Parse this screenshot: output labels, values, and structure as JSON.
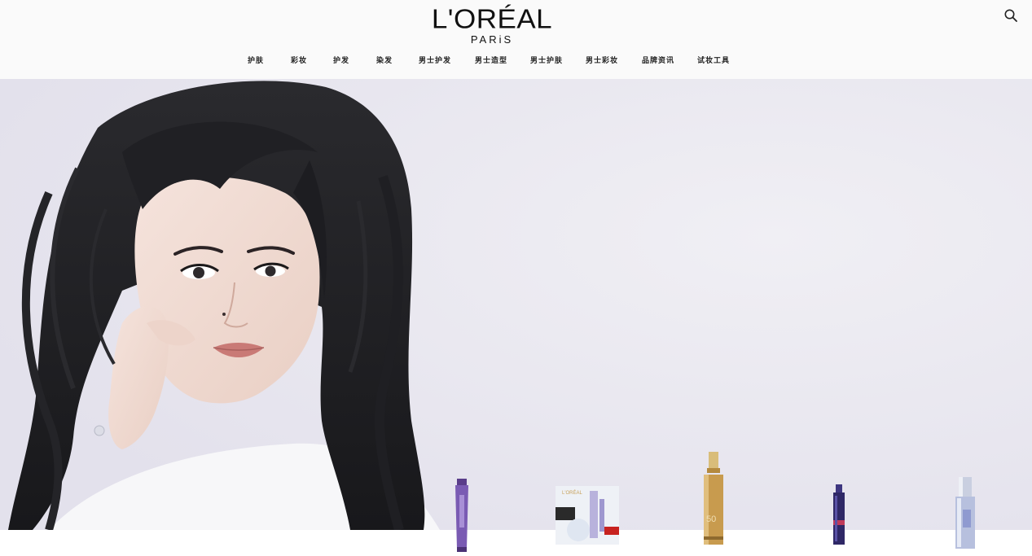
{
  "brand": {
    "name": "L'ORÉAL",
    "sub": "PARiS"
  },
  "search": {
    "icon": "search-icon"
  },
  "nav": {
    "items": [
      {
        "label": "护肤"
      },
      {
        "label": "彩妆"
      },
      {
        "label": "护发"
      },
      {
        "label": "染发"
      },
      {
        "label": "男士护发"
      },
      {
        "label": "男士造型"
      },
      {
        "label": "男士护肤"
      },
      {
        "label": "男士彩妆"
      },
      {
        "label": "品牌资讯"
      },
      {
        "label": "试妆工具"
      }
    ]
  },
  "hero": {
    "background": "#eceaf1"
  },
  "products": [
    {
      "name": "eye-cream-tube",
      "color": "#6d4fa3"
    },
    {
      "name": "mask-pack",
      "color": "#dfe6f0"
    },
    {
      "name": "gold-serum-bottle",
      "color": "#c8a15a"
    },
    {
      "name": "night-serum-bottle",
      "color": "#2b2460"
    },
    {
      "name": "clear-essence-bottle",
      "color": "#b9c2de"
    }
  ]
}
